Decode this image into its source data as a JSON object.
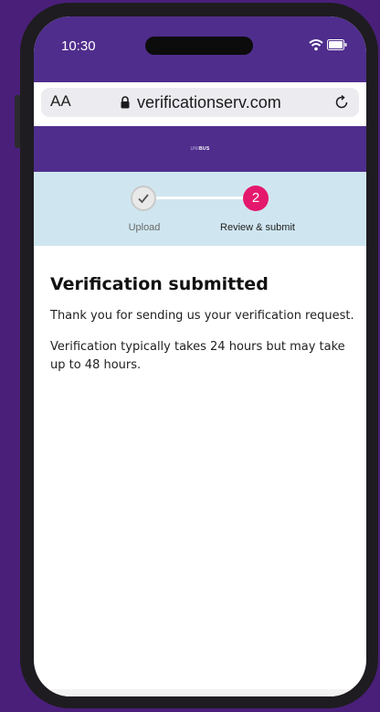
{
  "status_bar": {
    "time": "10:30"
  },
  "browser": {
    "text_size_label": "AA",
    "url": "verificationserv.com"
  },
  "site": {
    "logo_prefix": "UNI",
    "logo_brand": "BUS"
  },
  "stepper": {
    "steps": [
      {
        "label": "Upload",
        "state": "complete",
        "icon": "check-icon"
      },
      {
        "label": "Review & submit",
        "number": "2",
        "state": "current"
      }
    ],
    "accent_color": "#e4186c"
  },
  "main": {
    "title": "Verification submitted",
    "paragraph1": "Thank you for sending us your verification request.",
    "paragraph2": "Verification typically takes 24 hours but may take up to 48 hours."
  },
  "colors": {
    "header": "#4f2d8c",
    "background": "#4a1f7a",
    "stepper_band": "#cfe6f0"
  }
}
